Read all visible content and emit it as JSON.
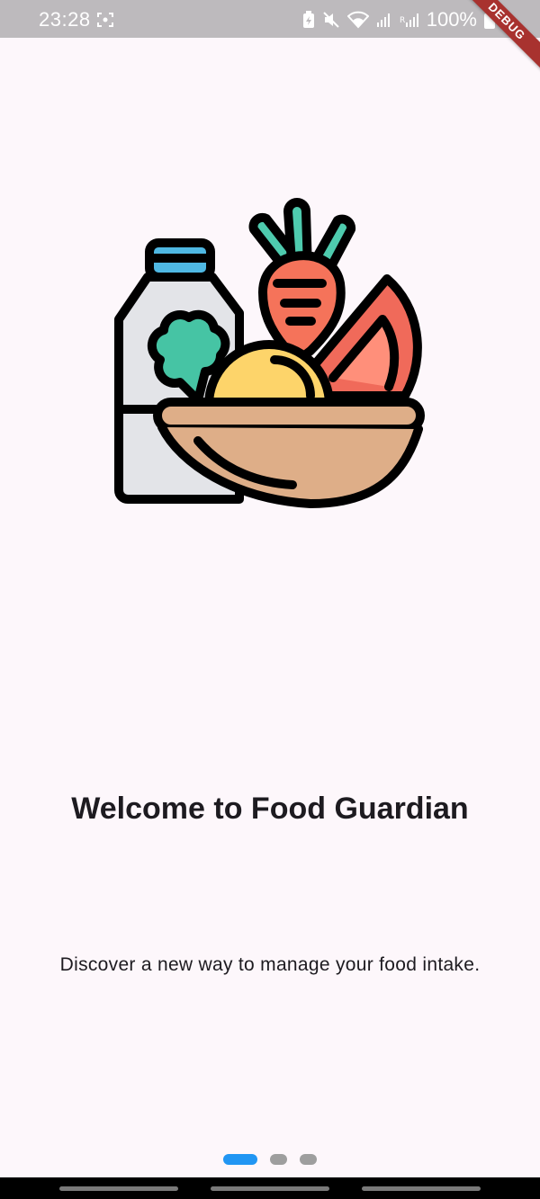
{
  "status_bar": {
    "time": "23:28",
    "battery": "100%"
  },
  "debug_banner": "DEBUG",
  "onboarding": {
    "title": "Welcome to Food Guardian",
    "subtitle": "Discover a new way to manage your food intake.",
    "illustration_icon": "food-basket-icon",
    "pages": 3,
    "active_page": 1
  },
  "colors": {
    "background": "#fdf7fb",
    "indicator_active": "#2196f3",
    "indicator_inactive": "#9e9e9e"
  }
}
